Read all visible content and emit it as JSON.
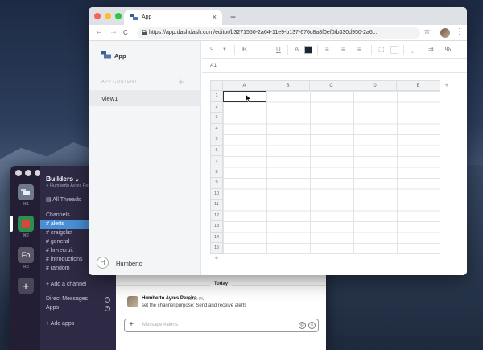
{
  "slack": {
    "team_name": "Builders",
    "team_chevron": "⌄",
    "user_status": "Humberto Ayres Pereira",
    "workspace_tiles": [
      {
        "label": "",
        "key": "⌘1",
        "color": "#6e7a8c",
        "icon": "builders-logo-icon"
      },
      {
        "label": "",
        "key": "⌘2",
        "color": "#2f8d4f",
        "icon": "workspace-icon"
      },
      {
        "label": "Fo",
        "key": "⌘3",
        "color": "#5a5668",
        "icon": ""
      }
    ],
    "add_workspace": "+",
    "all_threads": "All Threads",
    "channels_heading": "Channels",
    "channels": [
      "alerts",
      "craigslist",
      "general",
      "hr-recruit",
      "introductions",
      "random"
    ],
    "selected_channel": "alerts",
    "add_channel": "+ Add a channel",
    "dm_heading": "Direct Messages",
    "apps_heading": "Apps",
    "add_apps": "+ Add apps",
    "today_label": "Today",
    "message": {
      "author": "Humberto Ayres Pereira",
      "time": "12:19 PM",
      "text": "set the channel purpose: Send and receive alerts"
    },
    "composer_placeholder": "Message #alerts",
    "composer_plus": "+"
  },
  "browser": {
    "tab_title": "App",
    "tab_close": "×",
    "new_tab": "+",
    "back": "←",
    "forward": "→",
    "reload": "C",
    "url": "https://app.dashdash.com/editor/b3271550-2a64-11e9-b137-676c8a8f0ef0/b330d950-2a6...",
    "star": "☆",
    "menu": "⋮"
  },
  "app": {
    "name": "App",
    "section_label": "APP CONTENT",
    "add_label": "+",
    "views": [
      "View1"
    ],
    "user_initial": "H",
    "user_name": "Humberto",
    "toolbar": {
      "font_size": "9",
      "bold": "B",
      "italic": "T",
      "underline": "U",
      "text_color_glyph": "A",
      "percent": "%"
    },
    "cell_ref": "A1",
    "columns": [
      "A",
      "B",
      "C",
      "D",
      "E"
    ],
    "rows": [
      "1",
      "2",
      "3",
      "4",
      "5",
      "6",
      "7",
      "8",
      "9",
      "10",
      "11",
      "12",
      "13",
      "14",
      "15"
    ],
    "add_col": "+",
    "add_row": "+",
    "text_color": "#1b2537"
  }
}
